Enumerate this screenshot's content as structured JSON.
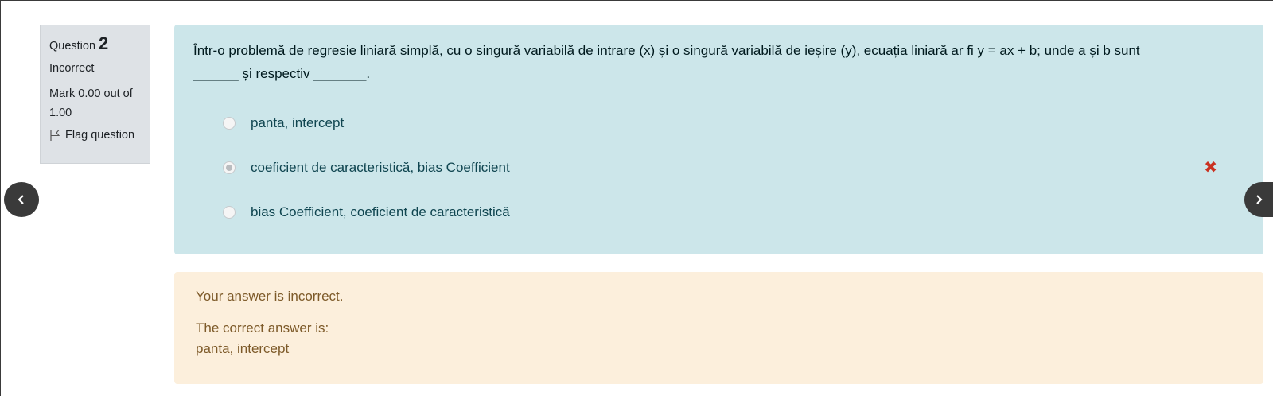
{
  "question_info": {
    "question_prefix": "Question",
    "question_number": "2",
    "state": "Incorrect",
    "grade": "Mark 0.00 out of 1.00",
    "flag_label": "Flag question"
  },
  "question": {
    "text": "Într-o problemă de regresie liniară simplă, cu o singură variabilă de intrare (x) și o singură variabilă de ieșire (y), ecuația liniară ar fi y = ax + b; unde a și b sunt ______ și respectiv _______.",
    "answers": [
      {
        "label": "panta, intercept",
        "selected": false
      },
      {
        "label": "coeficient de caracteristică, bias Coefficient",
        "selected": true,
        "incorrect": true
      },
      {
        "label": "bias Coefficient, coeficient de caracteristică",
        "selected": false
      }
    ],
    "incorrect_mark_icon": "cross-icon",
    "incorrect_color": "#ca3120"
  },
  "feedback": {
    "general": "Your answer is incorrect.",
    "right_answer_intro": "The correct answer is:",
    "right_answer": "panta, intercept"
  },
  "navigation": {
    "prev_icon": "chevron-left-icon",
    "next_icon": "chevron-right-icon"
  },
  "colors": {
    "formulation_bg": "#cce6ea",
    "feedback_bg": "#fcefdc",
    "info_bg": "#dee2e6"
  }
}
